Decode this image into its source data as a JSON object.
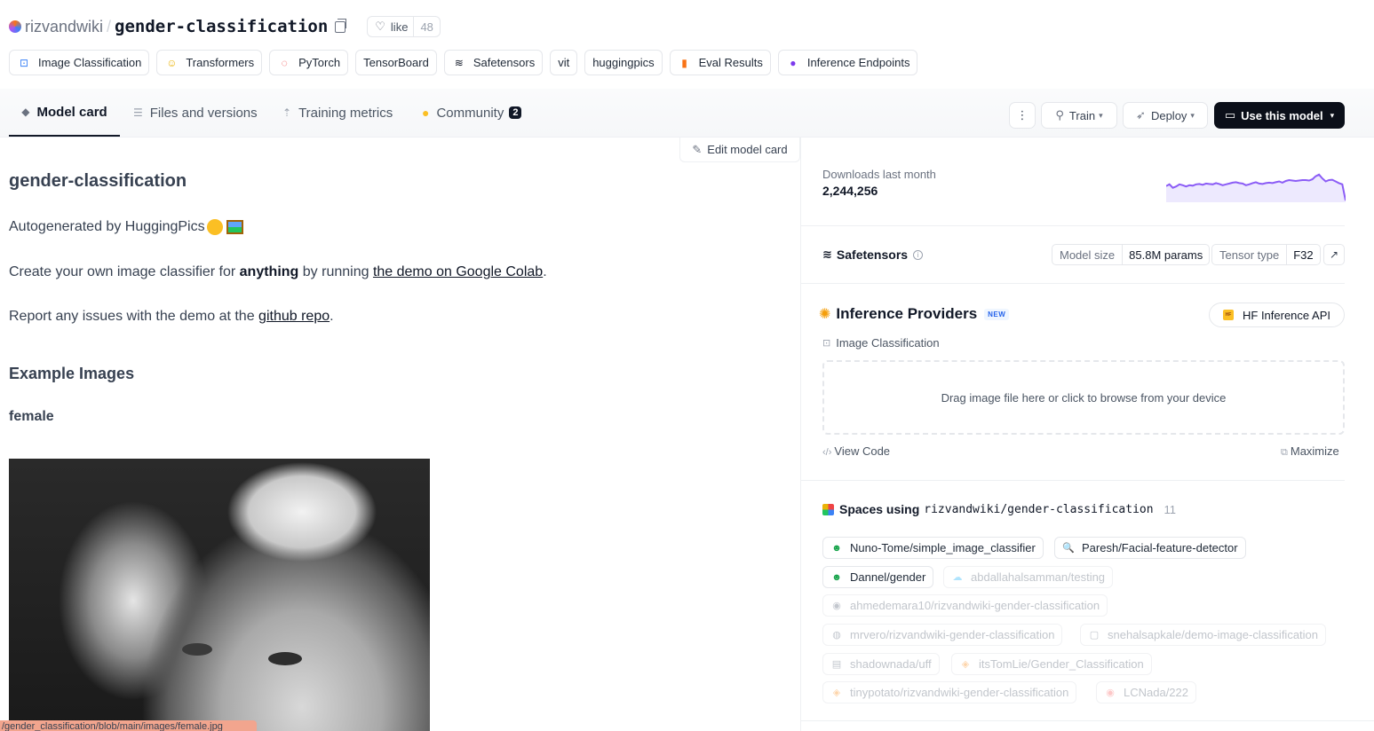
{
  "header": {
    "owner": "rizvandwiki",
    "separator": "/",
    "repo": "gender-classification",
    "like_label": "like",
    "like_count": "48"
  },
  "tags": [
    {
      "label": "Image Classification",
      "icon": "image-classification-icon",
      "glyph": "⊡",
      "color": "#3b82f6"
    },
    {
      "label": "Transformers",
      "icon": "hugging-face-icon",
      "glyph": "☺",
      "color": "#eab308"
    },
    {
      "label": "PyTorch",
      "icon": "pytorch-icon",
      "glyph": "◌",
      "color": "#ef4444"
    },
    {
      "label": "TensorBoard",
      "icon": "",
      "glyph": "",
      "color": ""
    },
    {
      "label": "Safetensors",
      "icon": "layers-icon",
      "glyph": "≋",
      "color": "#111827"
    },
    {
      "label": "vit",
      "icon": "",
      "glyph": "",
      "color": ""
    },
    {
      "label": "huggingpics",
      "icon": "",
      "glyph": "",
      "color": ""
    },
    {
      "label": "Eval Results",
      "icon": "bar-chart-icon",
      "glyph": "▮",
      "color": "#f97316"
    },
    {
      "label": "Inference Endpoints",
      "icon": "endpoints-icon",
      "glyph": "●",
      "color": "#7c3aed"
    }
  ],
  "tabs": {
    "model_card": "Model card",
    "files": "Files and versions",
    "metrics": "Training metrics",
    "community": "Community",
    "community_count": "2"
  },
  "actions": {
    "more": "⋮",
    "train": "Train",
    "deploy": "Deploy",
    "use_model": "Use this model"
  },
  "card": {
    "edit_label": "Edit model card",
    "heading": "gender-classification",
    "autogen_text": "Autogenerated by HuggingPics",
    "p2_before": "Create your own image classifier for ",
    "p2_bold": "anything",
    "p2_mid": " by running ",
    "p2_link": "the demo on Google Colab",
    "p2_after": ".",
    "p3_before": "Report any issues with the demo at the ",
    "p3_link": "github repo",
    "p3_after": ".",
    "examples_heading": "Example Images",
    "female_heading": "female",
    "status_url": "/gender_classification/blob/main/images/female.jpg"
  },
  "downloads": {
    "label": "Downloads last month",
    "value": "2,244,256",
    "trend": [
      62,
      58,
      66,
      63,
      58,
      60,
      63,
      60,
      61,
      58,
      57,
      59,
      56,
      57,
      58,
      55,
      57,
      60,
      58,
      56,
      54,
      53,
      55,
      56,
      60,
      58,
      55,
      53,
      56,
      57,
      55,
      54,
      55,
      53,
      51,
      54,
      50,
      48,
      49,
      50,
      49,
      48,
      48,
      49,
      46,
      39,
      35,
      44,
      51,
      48,
      47,
      51,
      55,
      58,
      96
    ],
    "accent_color": "#8b5cf6"
  },
  "safetensors": {
    "title": "Safetensors",
    "model_size_key": "Model size",
    "model_size_val": "85.8M params",
    "tensor_type_key": "Tensor type",
    "tensor_type_val": "F32",
    "ext_icon": "↗"
  },
  "inference": {
    "title": "Inference Providers",
    "new_badge": "NEW",
    "provider": "HF Inference API",
    "hf_mark": "HF",
    "task": "Image Classification",
    "dropzone": "Drag image file here or click to browse from your device",
    "view_code": "View Code",
    "maximize": "Maximize"
  },
  "spaces": {
    "title": "Spaces using",
    "repo": "rizvandwiki/gender-classification",
    "count": "11",
    "items": [
      {
        "label": "Nuno-Tome/simple_image_classifier",
        "glyph": "☻",
        "color": "#16a34a",
        "faded": false
      },
      {
        "label": "Paresh/Facial-feature-detector",
        "glyph": "🔍",
        "color": "#1f2937",
        "faded": false
      },
      {
        "label": "Dannel/gender",
        "glyph": "☻",
        "color": "#16a34a",
        "faded": false
      },
      {
        "label": "abdallahalsamman/testing",
        "glyph": "☁",
        "color": "#7dd3fc",
        "faded": true
      },
      {
        "label": "ahmedemara10/rizvandwiki-gender-classification",
        "glyph": "◉",
        "color": "#9ca3af",
        "faded": true
      },
      {
        "label": "mrvero/rizvandwiki-gender-classification",
        "glyph": "◍",
        "color": "#9ca3af",
        "faded": true
      },
      {
        "label": "snehalsapkale/demo-image-classification",
        "glyph": "▢",
        "color": "#9ca3af",
        "faded": true
      },
      {
        "label": "shadownada/uff",
        "glyph": "▤",
        "color": "#9ca3af",
        "faded": true
      },
      {
        "label": "itsTomLie/Gender_Classification",
        "glyph": "◈",
        "color": "#fdba74",
        "faded": true
      },
      {
        "label": "tinypotato/rizvandwiki-gender-classification",
        "glyph": "◈",
        "color": "#fdba74",
        "faded": true
      },
      {
        "label": "LCNada/222",
        "glyph": "◉",
        "color": "#fca5a5",
        "faded": true
      }
    ]
  }
}
